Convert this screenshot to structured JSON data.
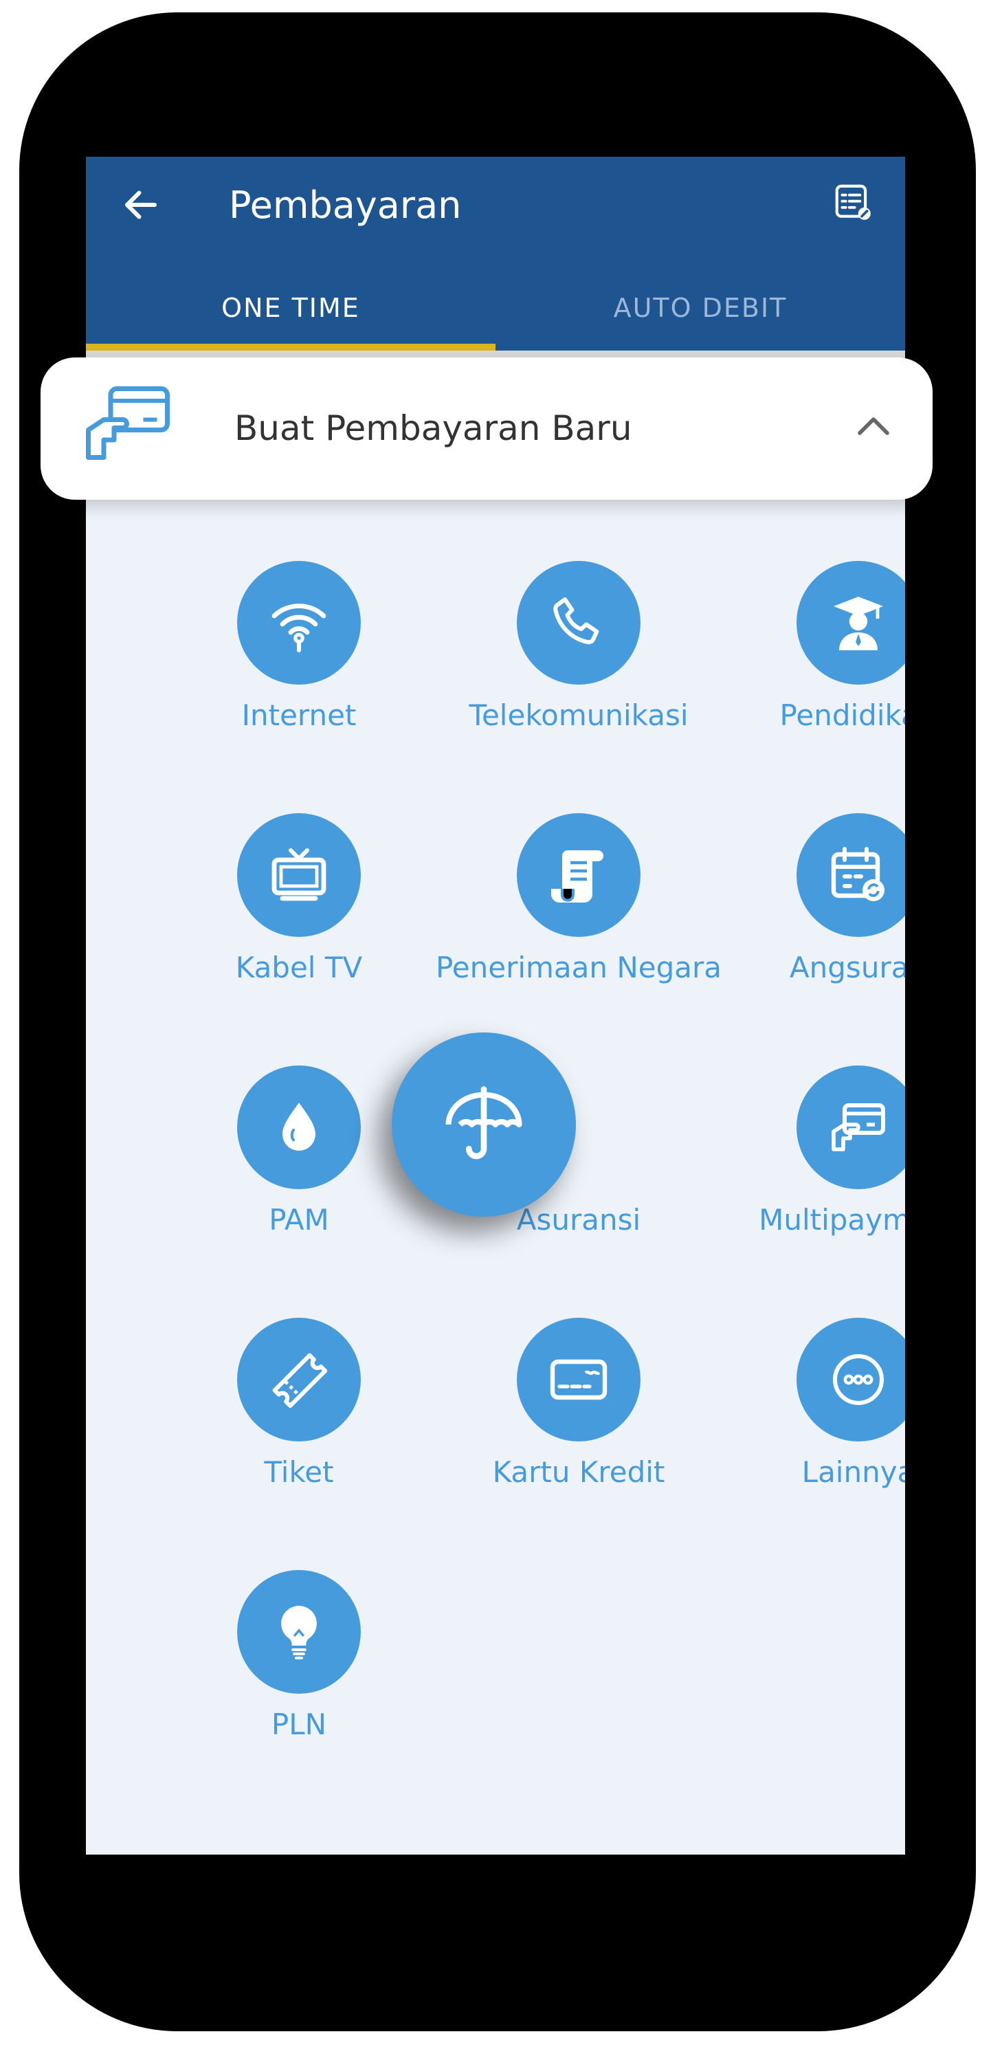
{
  "header": {
    "title": "Pembayaran",
    "back_icon": "arrow-left-icon",
    "history_icon": "receipt-list-icon"
  },
  "tabs": [
    {
      "label": "ONE TIME",
      "active": true
    },
    {
      "label": "AUTO DEBIT",
      "active": false
    }
  ],
  "new_payment": {
    "label": "Buat Pembayaran Baru",
    "icon": "card-hand-icon",
    "chevron_icon": "chevron-up-icon"
  },
  "categories": [
    {
      "label": "Internet",
      "icon": "wifi-icon"
    },
    {
      "label": "Telekomunikasi",
      "icon": "phone-icon"
    },
    {
      "label": "Pendidikan",
      "icon": "graduate-icon"
    },
    {
      "label": "Kabel TV",
      "icon": "tv-icon"
    },
    {
      "label": "Penerimaan Negara",
      "icon": "scroll-icon"
    },
    {
      "label": "Angsuran",
      "icon": "calendar-icon"
    },
    {
      "label": "PAM",
      "icon": "water-drop-icon"
    },
    {
      "label": "Asuransi",
      "icon": "umbrella-icon"
    },
    {
      "label": "Multipayment",
      "icon": "card-hand-icon"
    },
    {
      "label": "Tiket",
      "icon": "ticket-icon"
    },
    {
      "label": "Kartu Kredit",
      "icon": "credit-card-icon"
    },
    {
      "label": "Lainnya",
      "icon": "more-icon"
    },
    {
      "label": "PLN",
      "icon": "lightbulb-icon"
    }
  ],
  "colors": {
    "header_bg": "#1e5590",
    "accent": "#459bdc",
    "tab_indicator": "#d9b520",
    "screen_bg": "#eef3f9"
  }
}
